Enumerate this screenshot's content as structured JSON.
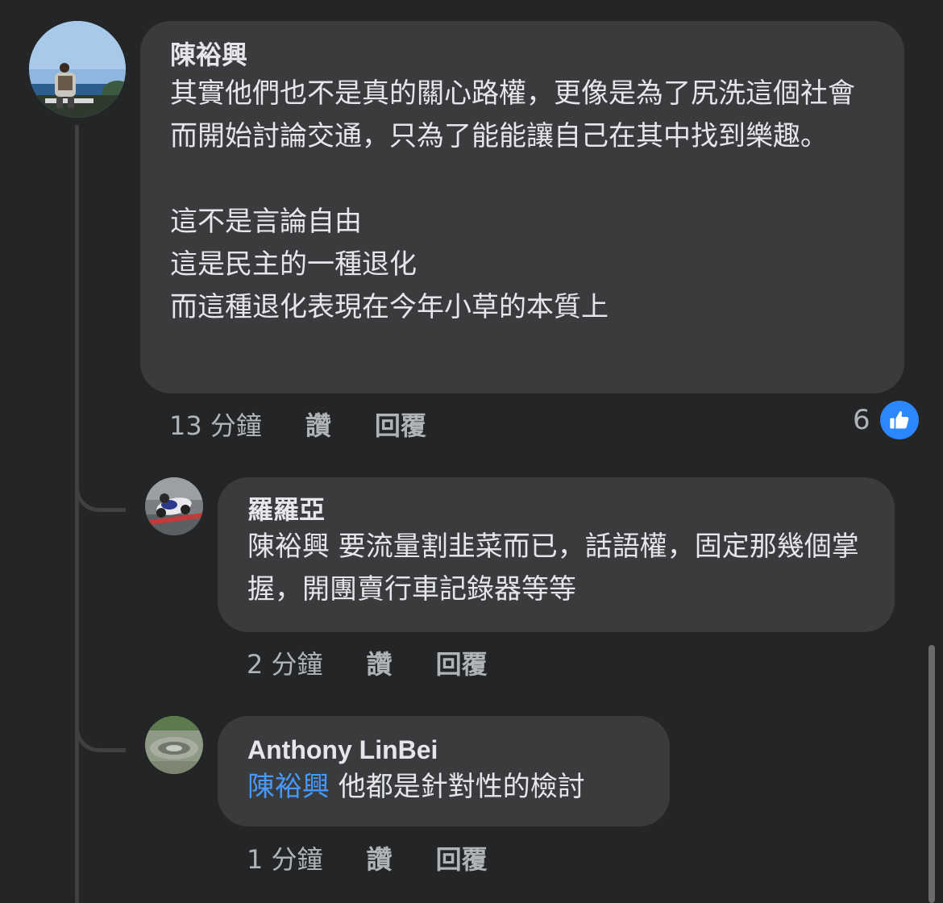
{
  "comments": [
    {
      "author": "陳裕興",
      "text": "其實他們也不是真的關心路權，更像是為了尻洗這個社會而開始討論交通，只為了能能讓自己在其中找到樂趣。\n\n這不是言論自由\n這是民主的一種退化\n而這種退化表現在今年小草的本質上",
      "time": "13 分鐘",
      "like_label": "讚",
      "reply_label": "回覆",
      "reaction_count": "6",
      "reaction_icon": "thumbs-up-icon"
    }
  ],
  "replies": [
    {
      "author": "羅羅亞",
      "text": "陳裕興 要流量割韭菜而已，話語權，固定那幾個掌握，開團賣行車記錄器等等",
      "time": "2 分鐘",
      "like_label": "讚",
      "reply_label": "回覆"
    },
    {
      "author": "Anthony LinBei",
      "mention": "陳裕興",
      "text": " 他都是針對性的檢討",
      "time": "1 分鐘",
      "like_label": "讚",
      "reply_label": "回覆"
    }
  ],
  "colors": {
    "background": "#242526",
    "bubble": "#3a3b3c",
    "mention": "#4599ff",
    "like_badge": "#2d88ff",
    "secondary_text": "#b0b3b8"
  }
}
